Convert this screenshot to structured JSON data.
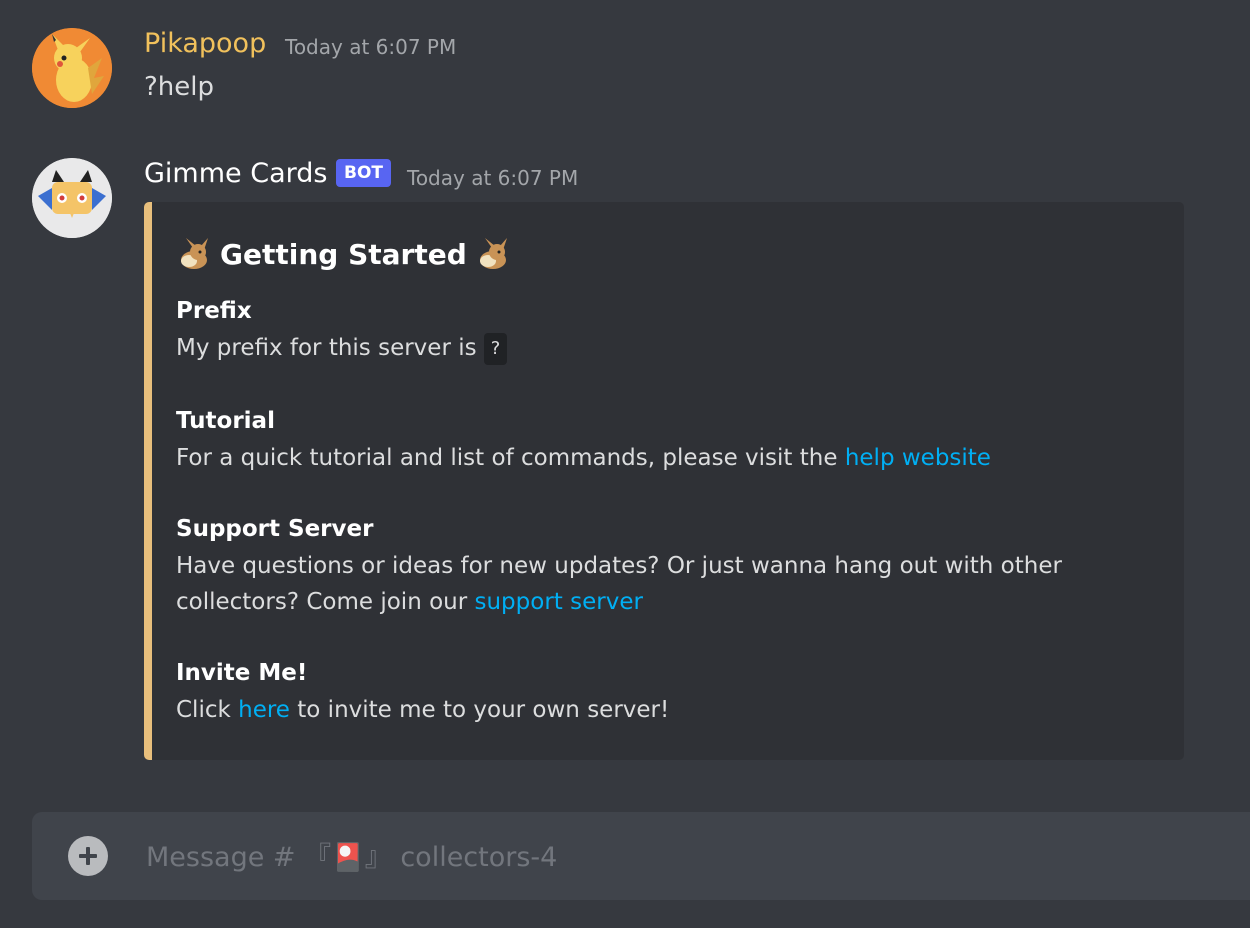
{
  "messages": [
    {
      "username": "Pikapoop",
      "username_color": "#f1c15c",
      "timestamp": "Today at 6:07 PM",
      "text": "?help"
    },
    {
      "username": "Gimme Cards",
      "username_color": "#ffffff",
      "bot_tag": "BOT",
      "timestamp": "Today at 6:07 PM",
      "embed": {
        "title": "Getting Started",
        "title_icon": "eevee-icon",
        "bar_color": "#e8bf7c",
        "fields": [
          {
            "name": "Prefix",
            "text": "My prefix for this server is ",
            "code": "?"
          },
          {
            "name": "Tutorial",
            "text": "For a quick tutorial and list of commands, please visit the ",
            "link": "help website"
          },
          {
            "name": "Support Server",
            "text": "Have questions or ideas for new updates? Or just wanna hang out with other collectors? Come join our ",
            "link": "support server"
          },
          {
            "name": "Invite Me!",
            "text_before": "Click ",
            "link": "here",
            "text_after": " to invite me to your own server!"
          }
        ]
      }
    }
  ],
  "composer": {
    "placeholder": "Message # 『🎴』 collectors-4",
    "add_icon": "plus-circle-icon"
  }
}
